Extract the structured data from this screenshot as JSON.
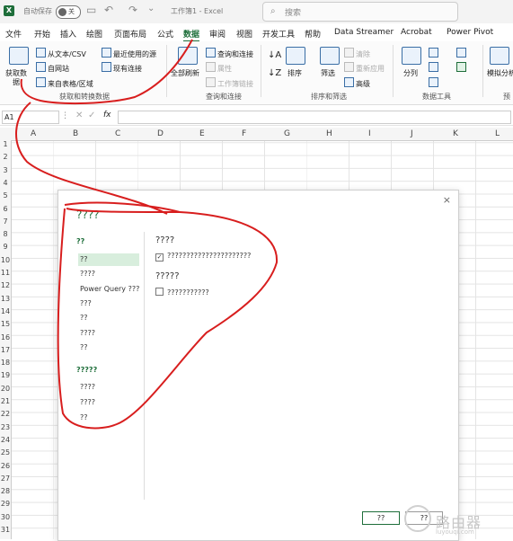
{
  "titlebar": {
    "app_icon": "X",
    "autosave_label": "自动保存",
    "autosave_state": "关",
    "document_title": "工作簿1 - Excel",
    "search_placeholder": "搜索"
  },
  "menu": {
    "items": [
      "文件",
      "开始",
      "插入",
      "绘图",
      "页面布局",
      "公式",
      "数据",
      "审阅",
      "视图",
      "开发工具",
      "帮助",
      "Data Streamer",
      "Acrobat",
      "Power Pivot"
    ],
    "active": "数据"
  },
  "ribbon": {
    "get_data": {
      "line1": "获取数",
      "line2": "据"
    },
    "from_text_csv": "从文本/CSV",
    "from_web": "自网站",
    "from_table_range": "来自表格/区域",
    "recent_sources": "最近使用的源",
    "existing_connections": "现有连接",
    "group_get_transform": "获取和转换数据",
    "refresh_all": "全部刷新",
    "queries_connections": "查询和连接",
    "properties": "属性",
    "workbook_links": "工作簿链接",
    "group_queries": "查询和连接",
    "sort": "排序",
    "filter": "筛选",
    "clear": "清除",
    "reapply": "重新应用",
    "advanced": "高级",
    "group_sort_filter": "排序和筛选",
    "split_columns": "分列",
    "group_data_tools": "数据工具",
    "what_if": "模拟分析",
    "group_forecast": "预"
  },
  "formula_bar": {
    "name_box": "A1",
    "fx": "fx",
    "formula": ""
  },
  "sheet": {
    "columns": [
      "A",
      "B",
      "C",
      "D",
      "E",
      "F",
      "G",
      "H",
      "I",
      "J",
      "K",
      "L"
    ],
    "rows": [
      "1",
      "2",
      "3",
      "4",
      "5",
      "6",
      "7",
      "8",
      "9",
      "10",
      "11",
      "12",
      "13",
      "14",
      "15",
      "16",
      "17",
      "18",
      "19",
      "20",
      "21",
      "22",
      "23",
      "24",
      "25",
      "26",
      "27",
      "28",
      "29",
      "30",
      "31"
    ]
  },
  "dialog": {
    "close": "×",
    "title": "????",
    "nav_head_1": "??",
    "nav_items_1": [
      "??",
      "????",
      "Power Query ???",
      "???",
      "??",
      "????",
      "??"
    ],
    "nav_selected": 0,
    "nav_head_2": "?????",
    "nav_items_2": [
      "????",
      "????",
      "??"
    ],
    "section1_title": "????",
    "section1_option": "??????????????????????",
    "section1_checked": true,
    "section2_title": "?????",
    "section2_option": "???????????",
    "section2_checked": false,
    "ok": "??",
    "cancel": "??"
  },
  "watermark": {
    "text": "路由器",
    "url": "luyouqi.com"
  },
  "colors": {
    "excel_green": "#1e6e3a",
    "annotation_red": "#d81e1e"
  }
}
